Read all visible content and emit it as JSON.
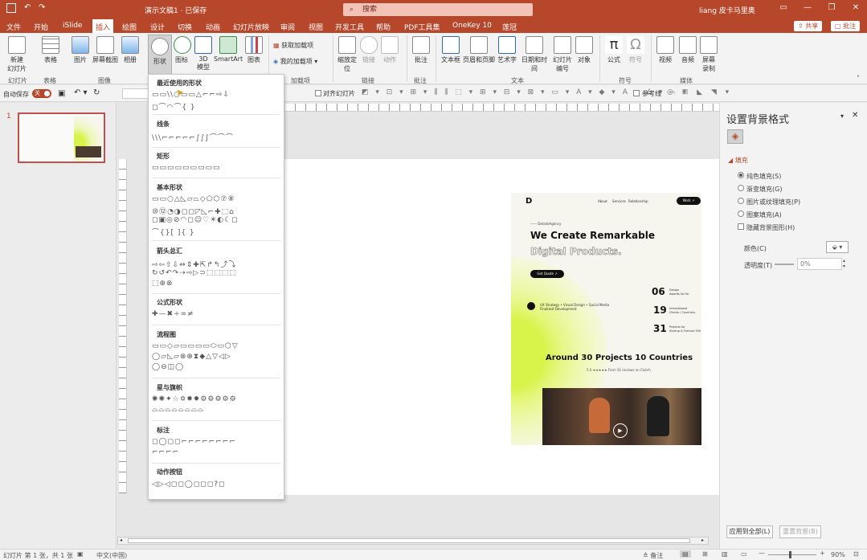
{
  "titlebar": {
    "doc_title": "演示文稿1 · 已保存",
    "search_placeholder": "搜索",
    "user_name": "liang 皮卡马里奥",
    "min": "—",
    "restore": "❐",
    "close": "✕"
  },
  "menu": {
    "items": [
      "文件",
      "开始",
      "iSlide",
      "插入",
      "绘图",
      "设计",
      "切换",
      "动画",
      "幻灯片放映",
      "审阅",
      "视图",
      "开发工具",
      "帮助",
      "PDF工具集",
      "OneKey 10",
      "莲冠"
    ],
    "share": "共享",
    "comment": "批注"
  },
  "ribbon": {
    "buttons": [
      "新建\n幻灯片",
      "表格",
      "图片",
      "屏幕截图",
      "相册",
      "形状",
      "图标",
      "3D\n模型",
      "SmartArt",
      "图表",
      "获取加载项",
      "我的加载项",
      "缩放定\n位",
      "链接",
      "动作",
      "批注",
      "文本框",
      "页眉和页脚",
      "艺术字",
      "日期和时间",
      "幻灯片\n编号",
      "对象",
      "公式",
      "符号",
      "视频",
      "音频",
      "屏幕\n录制"
    ],
    "groups": [
      "幻灯片",
      "表格",
      "图像",
      "加载项",
      "链接",
      "批注",
      "文本",
      "符号",
      "媒体"
    ]
  },
  "quickbar": {
    "autosave_label": "自动保存",
    "autosave_state": "关",
    "align_label": "对齐幻灯片",
    "ref_label": "参考线"
  },
  "thumbs": {
    "slide_number": "1"
  },
  "dropdown": {
    "sections": [
      {
        "title": "最近使用的形状",
        "rows": [
          "▭▭\\\\○▭▭△⌐⌐⇨⇩",
          "◻⌒◠⌒{ }"
        ]
      },
      {
        "title": "线条",
        "rows": [
          "\\\\\\⌐⌐⌐⌐⌐∫∫∫⌒⌒⌒"
        ]
      },
      {
        "title": "矩形",
        "rows": [
          "▭▭▭▭▭▭▭▭▭"
        ]
      },
      {
        "title": "基本形状",
        "rows": [
          "▭▭○△◺▱⏢◇⬠⬡⑦⑧",
          "⑩⑫◔◑◻◻◸◺⌐✚⬚⌂",
          "◻▣◎⊘◠◻☺♡☀◐☾◻",
          "⌒{}[ ]{ }"
        ]
      },
      {
        "title": "箭头总汇",
        "rows": [
          "⇨⇦⇧⇩⇔⇕✚⇱↱↰⤴⤵",
          "↻↺↶↷⇢⇨▷⊃⬚⬚⬚⬚",
          "⬚⊕⊗"
        ]
      },
      {
        "title": "公式形状",
        "rows": [
          "✚—✖÷=≠"
        ]
      },
      {
        "title": "流程图",
        "rows": [
          "▭▭◇▱▭▭▭▭⬭▭⬡▽",
          "◯▱◺▱⊗⊕⧗◆△▽◁▷",
          "◯⊖◫◯"
        ]
      },
      {
        "title": "星与旗帜",
        "rows": [
          "✺✺✦☆✡✹✹⚙⚙⚙⚙⚙",
          "⌓⌓⌓⌓⌓⌓⌓⌓"
        ]
      },
      {
        "title": "标注",
        "rows": [
          "◻◯◻◻⌐⌐⌐⌐⌐⌐⌐⌐",
          "⌐⌐⌐⌐"
        ]
      },
      {
        "title": "动作按钮",
        "rows": [
          "◁▷◁◻◻◯◻◻◻?◻"
        ]
      }
    ]
  },
  "web": {
    "brand": "D",
    "nav": [
      "About",
      "Services",
      "Relationship"
    ],
    "nav_btn": "Work ↗",
    "eyebrow": "—— DetaileAgency",
    "h1a": "We Create Remarkable",
    "h1b": "Digital Products.",
    "cta": "Get Quote ↗",
    "blurb": "UX Strategy • Visual Design • Social Media\nFinalized Development",
    "stats": [
      {
        "n": "06",
        "t": "Design\nAwards So Far"
      },
      {
        "n": "19",
        "t": "International\nClients / Countries"
      },
      {
        "n": "31",
        "t": "Projects for\nStartup & Fortune 500"
      }
    ],
    "h2": "Around 30 Projects 10 Countries",
    "rating": "5.0 ★★★★★ From 5k reviews on Clutch"
  },
  "rightpane": {
    "title": "设置背景格式",
    "fill_section": "填充",
    "options": [
      "纯色填充(S)",
      "渐变填充(G)",
      "图片或纹理填充(P)",
      "图案填充(A)"
    ],
    "hide_bg": "隐藏背景图形(H)",
    "color_label": "颜色(C)",
    "transparency_label": "透明度(T)",
    "transparency_value": "0%",
    "apply_all": "应用到全部(L)",
    "reset": "重置背景(B)"
  },
  "status": {
    "slide_info": "幻灯片 第 1 张，共 1 张",
    "lang": "中文(中国)",
    "notes": "备注",
    "zoom": "90%"
  },
  "colors": {
    "accent": "#b7472a",
    "web_lime": "#d8f44a"
  }
}
